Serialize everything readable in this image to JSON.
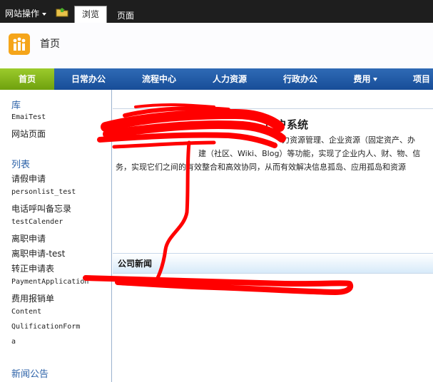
{
  "ribbon": {
    "site_actions": "网站操作",
    "tabs": [
      {
        "label": "浏览",
        "active": true
      },
      {
        "label": "页面",
        "active": false
      }
    ]
  },
  "header": {
    "title": "首页",
    "logo_color": "#f5a51a"
  },
  "topnav": {
    "items": [
      {
        "label": "首页",
        "active": true
      },
      {
        "label": "日常办公"
      },
      {
        "label": "流程中心"
      },
      {
        "label": "人力资源"
      },
      {
        "label": "行政办公"
      },
      {
        "label": "费用",
        "has_dropdown": true
      },
      {
        "label": "项目"
      }
    ],
    "active_color": "#8cbd1f",
    "bar_color": "#1f5aa6"
  },
  "leftnav": {
    "libraries_heading": "库",
    "libraries": [
      "EmaiTest",
      "网站页面"
    ],
    "lists_heading": "列表",
    "lists": [
      "请假申请",
      "personlist_test",
      "电话呼叫备忘录",
      "testCalender",
      "离职申请",
      "离职申请-test",
      "转正申请表",
      "PaymentApplication",
      "费用报销单",
      "Content",
      "QulificationForm",
      "a"
    ],
    "news_heading": "新闻公告"
  },
  "main": {
    "title": "门户系统",
    "body_line1": "力资源管理、企业资源（固定资产、办",
    "body_line2": "建（社区、Wiki、Blog）等功能，实现了企业内人、财、物、信",
    "body_line3": "务，实现它们之间的有效整合和高效协同，从而有效解决信息孤岛、应用孤岛和资源",
    "news_title": "公司新闻"
  },
  "annotation_color": "#ff0000"
}
